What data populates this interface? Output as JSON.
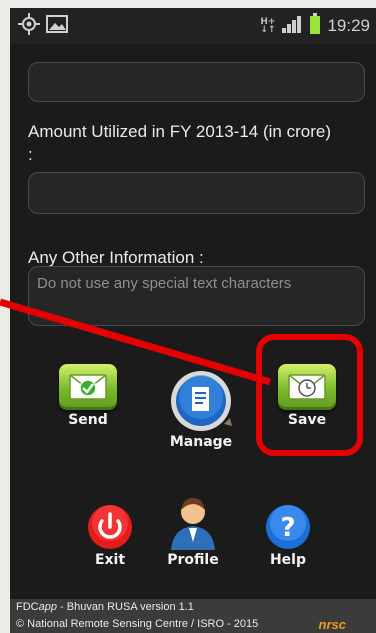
{
  "status_bar": {
    "time": "19:29",
    "network_label_top": "H+",
    "network_label_bottom": "↓↑"
  },
  "form": {
    "amount_label": "Amount Utilized in FY 2013-14 (in crore)",
    "amount_label_suffix": ":",
    "amount_value": "",
    "other_info_label": "Any Other Information :",
    "other_info_placeholder": "Do not use any special text characters",
    "other_info_value": ""
  },
  "actions": {
    "send": "Send",
    "manage": "Manage",
    "save": "Save",
    "exit": "Exit",
    "profile": "Profile",
    "help": "Help"
  },
  "footer": {
    "app_prefix": "FDC",
    "app_italic": "app",
    "app_rest": " - Bhuvan RUSA version 1.1",
    "copyright": "© National Remote Sensing Centre / ISRO - 2015",
    "logo_text": "nrsc"
  },
  "colors": {
    "annotation_red": "#e40000",
    "tile_green": "#7ab92b",
    "exit_red": "#e41b1b",
    "help_blue": "#1b6fd8"
  },
  "icons": {
    "gps": "crosshair-icon",
    "gallery": "image-icon",
    "signal": "signal-bars-icon",
    "battery": "battery-icon",
    "send": "envelope-check-icon",
    "manage": "document-icon",
    "save": "envelope-clock-icon",
    "exit": "power-icon",
    "profile": "user-icon",
    "help": "question-icon"
  }
}
